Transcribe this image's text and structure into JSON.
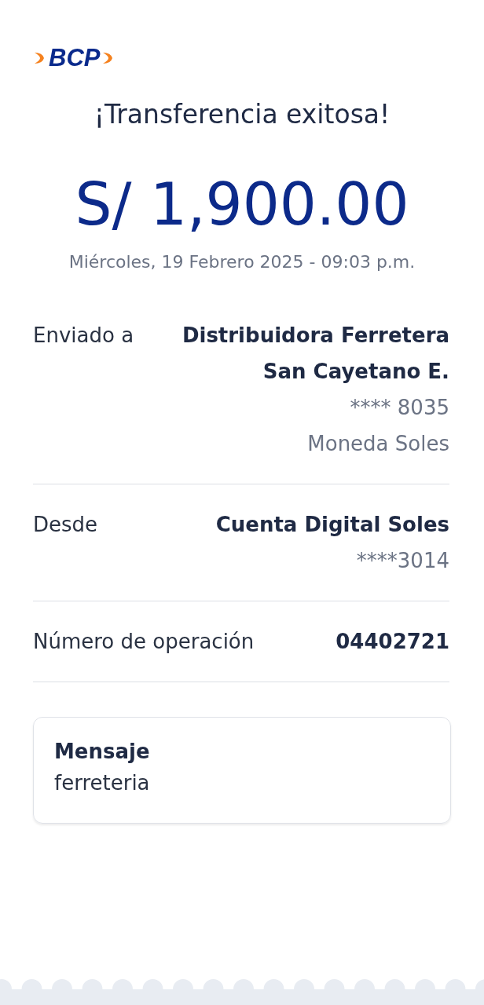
{
  "logo": {
    "text": "BCP"
  },
  "title": "¡Transferencia exitosa!",
  "amount": "S/ 1,900.00",
  "date": "Miércoles, 19 Febrero 2025 - 09:03 p.m.",
  "details": [
    {
      "label": "Enviado a",
      "values": [
        {
          "text": "Distribuidora Ferretera San Cayetano E.",
          "kind": "strong"
        },
        {
          "text": "**** 8035",
          "kind": "muted"
        },
        {
          "text": "Moneda Soles",
          "kind": "muted"
        }
      ]
    },
    {
      "label": "Desde",
      "values": [
        {
          "text": "Cuenta Digital Soles",
          "kind": "strong"
        },
        {
          "text": "****3014",
          "kind": "muted"
        }
      ]
    },
    {
      "label": "Número de operación",
      "values": [
        {
          "text": "04402721",
          "kind": "strong"
        }
      ]
    }
  ],
  "message": {
    "title": "Mensaje",
    "text": "ferreteria"
  }
}
